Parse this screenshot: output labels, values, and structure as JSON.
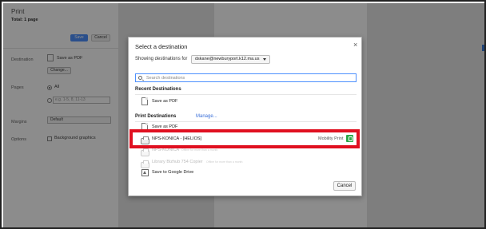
{
  "settings": {
    "title": "Print",
    "subtitle": "Total: 1 page",
    "save_label": "Save",
    "cancel_label": "Cancel",
    "destination_label": "Destination",
    "destination_value": "Save as PDF",
    "change_label": "Change...",
    "pages_label": "Pages",
    "pages_all": "All",
    "pages_placeholder": "e.g. 1-5, 8, 11-13",
    "margins_label": "Margins",
    "margins_value": "Default",
    "options_label": "Options",
    "background_graphics": "Background graphics"
  },
  "dialog": {
    "title": "Select a destination",
    "close_glyph": "×",
    "showing_label": "Showing destinations for",
    "account": "dskane@newburyport.k12.ma.us",
    "search_placeholder": "Search destinations",
    "recent_heading": "Recent Destinations",
    "recent_items": [
      "Save as PDF"
    ],
    "print_heading": "Print Destinations",
    "manage_label": "Manage...",
    "print_items": {
      "pdf": "Save as PDF",
      "konica": "NPS-KONICA - [HELIOS]",
      "mobility": "Mobility Print",
      "konica2": "NPS-KONICA",
      "konica2_note": "Offline for more than a month",
      "bizhub": "Library Bizhub 754 Copier",
      "bizhub_note": "Offline for more than a month",
      "drive": "Save to Google Drive"
    },
    "cancel_label": "Cancel"
  },
  "colors": {
    "highlight": "#e01020",
    "accent": "#4d90fe",
    "mobility_badge": "#2ea84a"
  },
  "icons": {
    "pdf": "document-icon",
    "printer": "printer-icon",
    "drive": "google-drive-icon",
    "mobility": "mobility-print-icon",
    "search": "search-icon",
    "close": "close-icon"
  }
}
